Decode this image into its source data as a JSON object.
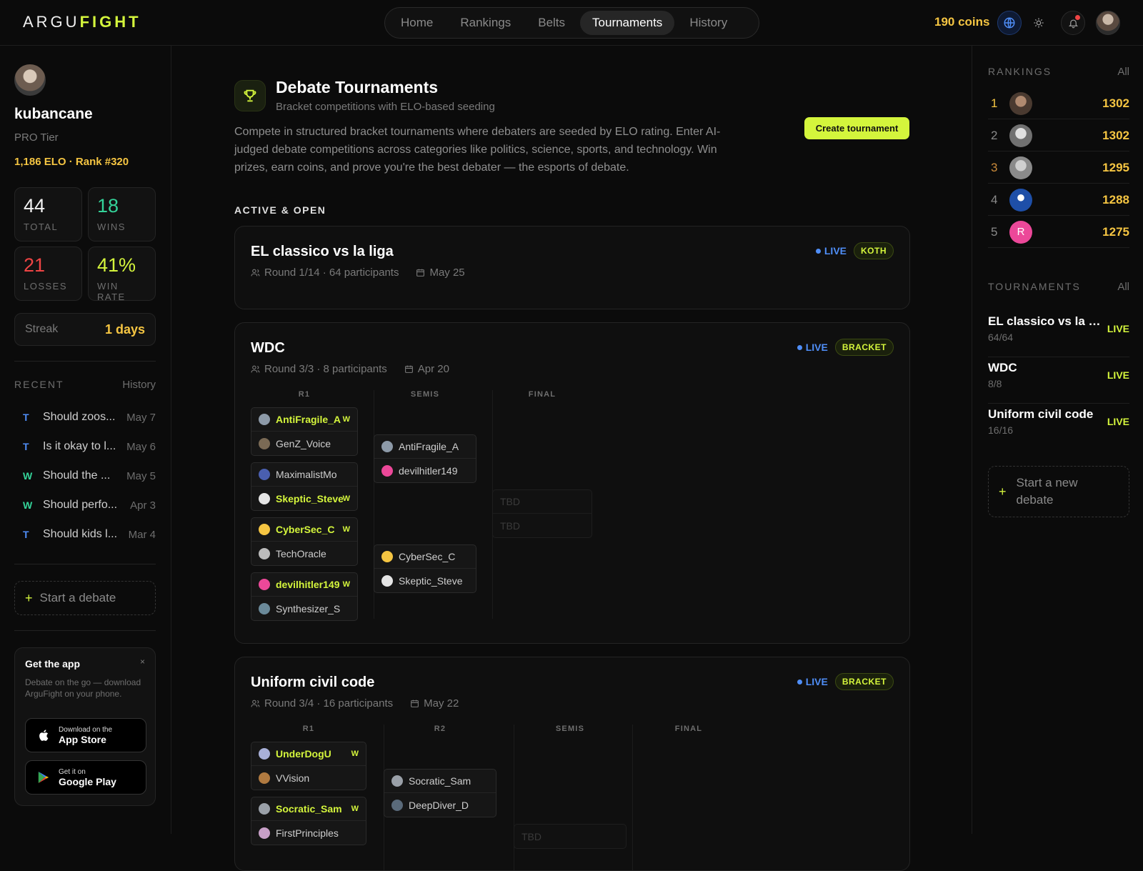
{
  "app": {
    "logo_a": "ARGU",
    "logo_b": "FIGHT"
  },
  "nav": {
    "items": [
      "Home",
      "Rankings",
      "Belts",
      "Tournaments",
      "History"
    ],
    "active": "Tournaments"
  },
  "topbar": {
    "coins": "190 coins"
  },
  "profile": {
    "username": "kubancane",
    "tier": "PRO Tier",
    "elo": "1,186 ELO",
    "rank": "Rank #320",
    "stats": [
      {
        "value": "44",
        "label": "TOTAL",
        "color": "#f0f0f0"
      },
      {
        "value": "18",
        "label": "WINS",
        "color": "#34d399"
      },
      {
        "value": "21",
        "label": "LOSSES",
        "color": "#ef4444"
      },
      {
        "value": "41%",
        "label": "WIN RATE",
        "color": "#d4f53c"
      }
    ],
    "streak_label": "Streak",
    "streak_value": "1 days"
  },
  "recent": {
    "title": "RECENT",
    "link": "History",
    "items": [
      {
        "tag": "T",
        "title": "Should zoos...",
        "date": "May 7"
      },
      {
        "tag": "T",
        "title": "Is it okay to l...",
        "date": "May 6"
      },
      {
        "tag": "W",
        "title": "Should the ...",
        "date": "May 5"
      },
      {
        "tag": "W",
        "title": "Should perfo...",
        "date": "Apr 3"
      },
      {
        "tag": "T",
        "title": "Should kids l...",
        "date": "Mar 4"
      }
    ]
  },
  "left_start": "Start a debate",
  "app_card": {
    "title": "Get the app",
    "close": "×",
    "desc": "Debate on the go — download ArguFight on your phone.",
    "appstore_small": "Download on the",
    "appstore_big": "App Store",
    "play_small": "Get it on",
    "play_big": "Google Play"
  },
  "main": {
    "title": "Debate Tournaments",
    "subtitle": "Bracket competitions with ELO-based seeding",
    "create": "Create tournament",
    "intro": "Compete in structured bracket tournaments where debaters are seeded by ELO rating. Enter AI-judged debate competitions across categories like politics, science, sports, and technology. Win prizes, earn coins, and prove you're the best debater — the esports of debate.",
    "section": "ACTIVE & OPEN",
    "live_label": "LIVE"
  },
  "tournaments": [
    {
      "name": "EL classico vs la liga",
      "meta": "Round 1/14 · 64 participants",
      "date": "May 25",
      "type": "KOTH"
    },
    {
      "name": "WDC",
      "meta": "Round 3/3 · 8 participants",
      "date": "Apr 20",
      "type": "BRACKET",
      "rounds": [
        "R1",
        "SEMIS",
        "FINAL"
      ],
      "r1": [
        [
          {
            "name": "AntiFragile_A",
            "win": true
          },
          {
            "name": "GenZ_Voice",
            "win": false
          }
        ],
        [
          {
            "name": "MaximalistMo",
            "win": false
          },
          {
            "name": "Skeptic_Steve",
            "win": true
          }
        ],
        [
          {
            "name": "CyberSec_C",
            "win": true
          },
          {
            "name": "TechOracle",
            "win": false
          }
        ],
        [
          {
            "name": "devilhitler149",
            "win": true
          },
          {
            "name": "Synthesizer_S",
            "win": false
          }
        ]
      ],
      "semis": [
        [
          {
            "name": "AntiFragile_A"
          },
          {
            "name": "devilhitler149"
          }
        ],
        [
          {
            "name": "CyberSec_C"
          },
          {
            "name": "Skeptic_Steve"
          }
        ]
      ],
      "final": [
        "TBD",
        "TBD"
      ]
    },
    {
      "name": "Uniform civil code",
      "meta": "Round 3/4 · 16 participants",
      "date": "May 22",
      "type": "BRACKET",
      "rounds": [
        "R1",
        "R2",
        "SEMIS",
        "FINAL"
      ],
      "r1": [
        [
          {
            "name": "UnderDogU",
            "win": true
          },
          {
            "name": "VVision",
            "win": false
          }
        ],
        [
          {
            "name": "Socratic_Sam",
            "win": true
          },
          {
            "name": "FirstPrinciples",
            "win": false
          }
        ]
      ],
      "r2": [
        [
          {
            "name": "Socratic_Sam"
          },
          {
            "name": "DeepDiver_D"
          }
        ]
      ],
      "semis_tbd": [
        "TBD"
      ]
    }
  ],
  "win_mark": "W",
  "rankings": {
    "title": "RANKINGS",
    "link": "All",
    "rows": [
      {
        "pos": "1",
        "elo": "1302",
        "highlight": true
      },
      {
        "pos": "2",
        "elo": "1302",
        "highlight": false
      },
      {
        "pos": "3",
        "elo": "1295",
        "highlight": true
      },
      {
        "pos": "4",
        "elo": "1288",
        "highlight": false
      },
      {
        "pos": "5",
        "elo": "1275",
        "highlight": false,
        "initial": "R"
      }
    ]
  },
  "side_tournaments": {
    "title": "TOURNAMENTS",
    "link": "All",
    "rows": [
      {
        "name": "EL classico vs la liga",
        "count": "64/64",
        "status": "LIVE"
      },
      {
        "name": "WDC",
        "count": "8/8",
        "status": "LIVE"
      },
      {
        "name": "Uniform civil code",
        "count": "16/16",
        "status": "LIVE"
      }
    ]
  },
  "right_start": "Start a new debate"
}
